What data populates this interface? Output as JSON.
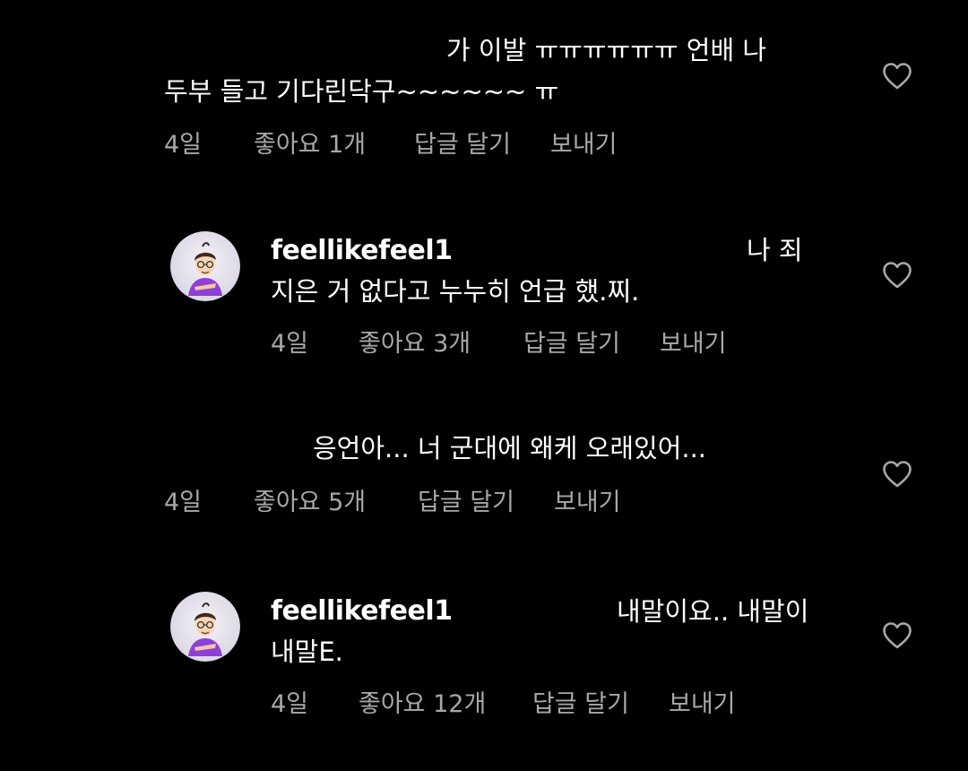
{
  "comments": [
    {
      "lines": [
        "가 이발 ㅠㅠㅠㅠㅠㅠ 언배 나",
        "두부 들고 기다린닥구~~~~~~ ㅠ"
      ],
      "time": "4일",
      "likes": "좋아요 1개",
      "reply": "답글 달기",
      "send": "보내기"
    },
    {
      "username": "feellikefeel1",
      "lines": [
        "나 죄",
        "지은 거 없다고 누누히 언급 했.찌."
      ],
      "time": "4일",
      "likes": "좋아요 3개",
      "reply": "답글 달기",
      "send": "보내기"
    },
    {
      "lines": [
        "응언아... 너 군대에 왜케 오래있어..."
      ],
      "time": "4일",
      "likes": "좋아요 5개",
      "reply": "답글 달기",
      "send": "보내기"
    },
    {
      "username": "feellikefeel1",
      "lines": [
        "내말이요.. 내말이",
        "내말E."
      ],
      "time": "4일",
      "likes": "좋아요 12개",
      "reply": "답글 달기",
      "send": "보내기"
    }
  ],
  "icons": {
    "like": "heart-outline-icon",
    "avatar": "avatar-illustration"
  },
  "colors": {
    "background": "#000000",
    "text": "#ffffff",
    "meta": "#a8a8a8",
    "avatar_bg": "#e9e6ef",
    "avatar_shirt": "#8f3fd6"
  }
}
